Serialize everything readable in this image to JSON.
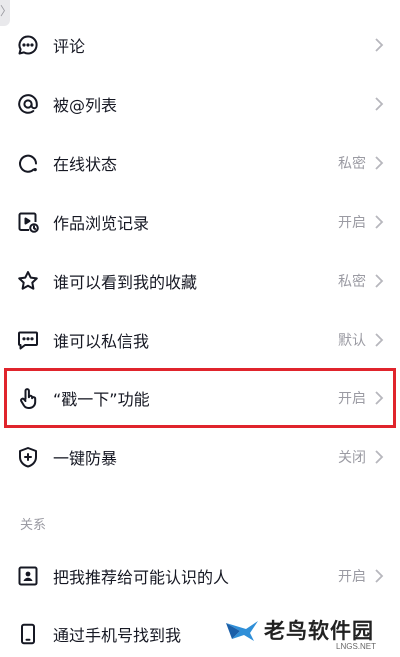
{
  "settings": {
    "rows": [
      {
        "label": "评论",
        "value": "",
        "icon": "comment-icon"
      },
      {
        "label": "被@列表",
        "value": "",
        "icon": "at-icon"
      },
      {
        "label": "在线状态",
        "value": "私密",
        "icon": "online-status-icon"
      },
      {
        "label": "作品浏览记录",
        "value": "开启",
        "icon": "play-history-icon"
      },
      {
        "label": "谁可以看到我的收藏",
        "value": "私密",
        "icon": "star-icon"
      },
      {
        "label": "谁可以私信我",
        "value": "默认",
        "icon": "message-icon"
      },
      {
        "label": "“戳一下”功能",
        "value": "开启",
        "icon": "finger-tap-icon"
      },
      {
        "label": "一键防暴",
        "value": "关闭",
        "icon": "shield-plus-icon"
      }
    ],
    "section_title": "关系",
    "relation_rows": [
      {
        "label": "把我推荐给可能认识的人",
        "value": "开启",
        "icon": "contact-card-icon"
      },
      {
        "label": "通过手机号找到我",
        "value": "",
        "icon": "phone-icon"
      }
    ]
  },
  "watermark": {
    "brand": "老鸟软件园",
    "domain": "LNGS.NET",
    "icon": "bird-logo-icon"
  },
  "colors": {
    "highlight": "#e0242c",
    "text": "#161823",
    "secondary": "#9b9ba3"
  }
}
